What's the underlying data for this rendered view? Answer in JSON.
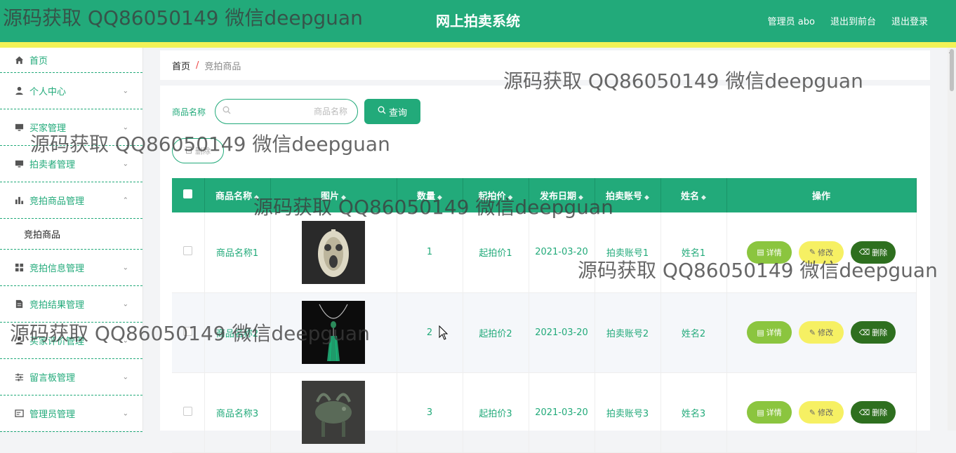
{
  "header": {
    "title": "网上拍卖系统",
    "admin_label": "管理员 abo",
    "back_front": "退出到前台",
    "logout": "退出登录"
  },
  "sidebar": {
    "items": [
      {
        "label": "首页",
        "icon": "home-icon"
      },
      {
        "label": "个人中心",
        "icon": "user-icon"
      },
      {
        "label": "买家管理",
        "icon": "monitor-icon"
      },
      {
        "label": "拍卖者管理",
        "icon": "monitor-icon"
      },
      {
        "label": "竞拍商品管理",
        "icon": "bar-chart-icon"
      },
      {
        "label": "竞拍商品",
        "icon": ""
      },
      {
        "label": "竞拍信息管理",
        "icon": "grid-icon"
      },
      {
        "label": "竞拍结果管理",
        "icon": "document-icon"
      },
      {
        "label": "买家评价管理",
        "icon": "user-icon"
      },
      {
        "label": "留言板管理",
        "icon": "sliders-icon"
      },
      {
        "label": "管理员管理",
        "icon": "card-icon"
      }
    ]
  },
  "breadcrumb": {
    "home": "首页",
    "sep": "/",
    "current": "竞拍商品"
  },
  "search": {
    "label": "商品名称",
    "placeholder": "商品名称",
    "button": "查询"
  },
  "toolbar": {
    "delete_label": "删除"
  },
  "table": {
    "columns": [
      "商品名称",
      "图片",
      "数量",
      "起拍价",
      "发布日期",
      "拍卖账号",
      "姓名",
      "操作"
    ],
    "rows": [
      {
        "name": "商品名称1",
        "qty": "1",
        "start_price": "起拍价1",
        "date": "2021-03-20",
        "account": "拍卖账号1",
        "person": "姓名1"
      },
      {
        "name": "商品名称2",
        "qty": "2",
        "start_price": "起拍价2",
        "date": "2021-03-20",
        "account": "拍卖账号2",
        "person": "姓名2"
      },
      {
        "name": "商品名称3",
        "qty": "3",
        "start_price": "起拍价3",
        "date": "2021-03-20",
        "account": "拍卖账号3",
        "person": "姓名3"
      }
    ],
    "actions": {
      "detail": "详情",
      "edit": "修改",
      "delete": "删除"
    }
  },
  "watermark": "源码获取 QQ86050149 微信deepguan",
  "colors": {
    "brand": "#22aa7a",
    "stripe": "#f2f256",
    "detail": "#8bc53f",
    "edit": "#f6f063",
    "delete": "#2e6f1f"
  }
}
